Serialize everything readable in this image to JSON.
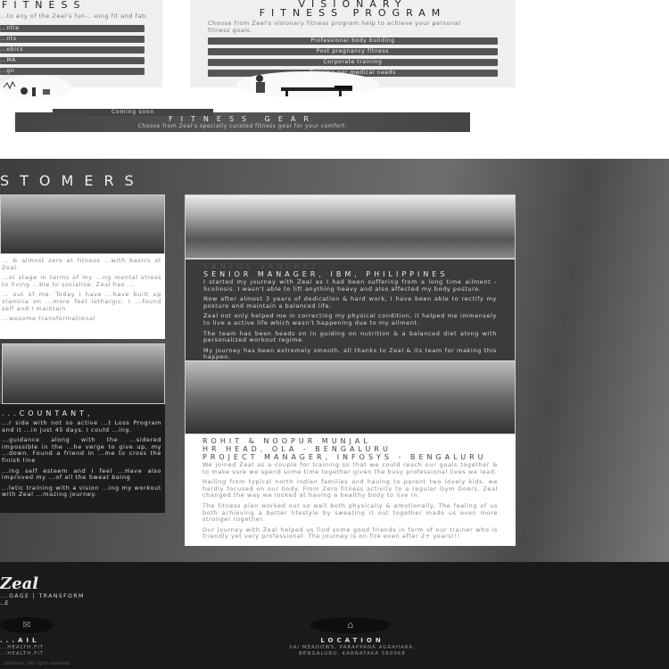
{
  "programs": {
    "left": {
      "title": "FITNESS",
      "subtitle": "...to any of the Zeal's fun-...eing fit and fab.",
      "items": [
        "...ntia",
        "...nts",
        "...obics",
        "...MA",
        "...gn"
      ]
    },
    "right": {
      "title_line1": "VISIONARY",
      "title_line2": "FITNESS PROGRAM",
      "subtitle": "Choose from Zeal's visionary fitness program help to achieve your personal fitness goals.",
      "items": [
        "Professional body building",
        "Post pregnancy fitness",
        "Corporate training",
        "Training per medical needs"
      ]
    }
  },
  "gear": {
    "badge": "Coming soon",
    "title": "FITNESS GEAR",
    "subtitle": "Choose from Zeal's specially curated fitness gear for your comfort."
  },
  "customers": {
    "title": "STOMERS",
    "left_top": {
      "paragraphs": [
        "... & almost zero at fitness ...with basics at Zeal.",
        "...st stage in terms of my ...ng mental stress to living ...ble to socialize. Zeal has ...",
        "... out of me. Today I have ...have built up stamina on ...more feel lethargic. I ...found self and I maintain",
        "...wesome transformational"
      ]
    },
    "left_bottom": {
      "name": "...COUNTANT,",
      "paragraphs": [
        "...r side with not so active ...t Loss Program and it ...in just 45 days. I could ...ing.",
        "...guidance along with the ...sidered impossible in the ...he verge to give up, my ...down. Found a friend in ...me to cross the finish line",
        "...ing self esteem and I feel ...Have also improved my ...of all the Sweat being",
        "...letic training with a vision ...ing my workout with Zeal ...mazing journey."
      ]
    },
    "right_top": {
      "name_line1": "SANTOS SANCHEZ",
      "name_line2": "SENIOR MANAGER, IBM, PHILIPPINES",
      "paragraphs": [
        "I started my journey with Zeal as I had been suffering from a long time ailment - Scoliosis. I wasn't able to lift anything heavy and also affected my body posture.",
        "Now after almost 3 years of dedication & hard work, I have been able to rectify my posture and maintain a balanced life.",
        "Zeal not only helped me in correcting my physical condition, it helped me immensely to live a active life which wasn't happening due to my ailment.",
        "The team has been heads on in guiding on nutrition & a balanced diet along with personalized workout regime.",
        "My journey has been extremely smooth, all thanks to Zeal & its team for making this happen."
      ]
    },
    "right_bottom": {
      "name_line1": "ROHIT & NOOPUR MUNJAL",
      "name_line2": "HR HEAD, OLA - BENGALURU",
      "name_line3": "PROJECT MANAGER, INFOSYS - BENGALURU",
      "paragraphs": [
        "We joined Zeal as a couple for training so that we could reach our goals together & to make sure we spend some time together given the busy professional lives we lead.",
        "Hailing from typical north Indian families and having to parent two lovely kids, we hardly focused on our body. From Zero fitness activity to a regular Gym Goers, Zeal changed the way we looked at having a healthy body to live in.",
        "The fitness plan worked out so well both physically & emotionally. The feeling of us both achieving a better lifestyle by sweating it out together made us even more stronger together.",
        "Our journey with Zeal helped us find some good friends in form of our trainer who is friendly yet very professional. The journey is on fire even after 2+ years!!!"
      ]
    }
  },
  "footer": {
    "logo": "Zeal",
    "tagline": "...GAGE | TRANSFORM",
    "tagline2": "...E",
    "email": {
      "label": "...AIL",
      "lines": [
        "...HEALTH.FIT",
        "...HEALTH.FIT"
      ]
    },
    "location": {
      "label": "LOCATION",
      "lines": [
        "SAI MEADOWS, PARAPPANA AGRAHARA,",
        "BENGALURU, KARNATAKA 560068"
      ]
    },
    "copyright": "...Solutions | All rights reserved"
  }
}
